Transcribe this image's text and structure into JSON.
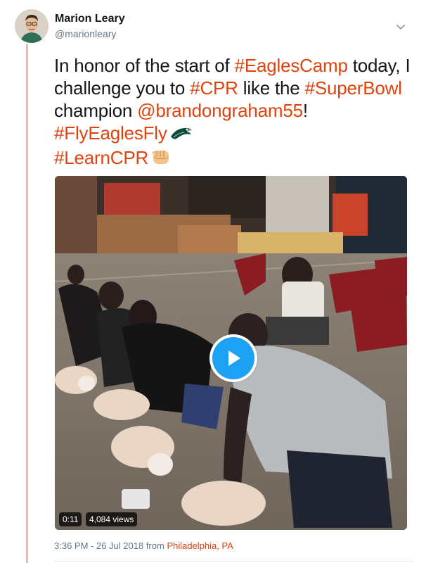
{
  "tweet": {
    "author_name": "Marion Leary",
    "author_handle": "@marionleary",
    "text_parts": {
      "p1": "In honor of the start of ",
      "tag_eaglescamp": "#EaglesCamp",
      "p2": " today, I challenge you to ",
      "tag_cpr": "#CPR",
      "p3": " like the ",
      "tag_superbowl": "#SuperBowl",
      "p4": " champion ",
      "mention": "@brandongraham55",
      "p5": "! ",
      "tag_flyeaglesfly": "#FlyEaglesFly",
      "tag_learncpr": "#LearnCPR"
    },
    "timestamp": "3:36 PM - 26 Jul 2018",
    "from_label": " from ",
    "location": "Philadelphia, PA"
  },
  "video": {
    "duration": "0:11",
    "views": "4,084 views"
  },
  "icons": {
    "caret": "chevron-down-icon",
    "play": "play-icon",
    "eagle_emoji": "eagle-icon",
    "fist_emoji": "fist-bump-icon"
  },
  "colors": {
    "link": "#e0440e",
    "thread_line": "#f6b7a8",
    "play_button": "#1da1f2",
    "secondary_text": "#657786"
  }
}
